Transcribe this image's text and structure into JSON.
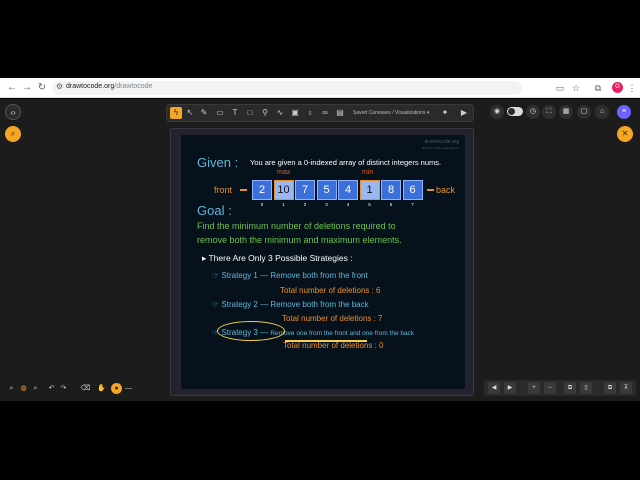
{
  "browser": {
    "url_host": "drawtocode.org",
    "url_path": "/drawtocode",
    "profile_initial": "G"
  },
  "toolbar": {
    "canvas_select": "Saved Canvases / Visualizations"
  },
  "board": {
    "watermark_site": "drawtocode.org",
    "watermark_tagline": "draw for more visualizations",
    "given_label": "Given :",
    "given_text": "You are given a 0-indexed array of distinct integers nums.",
    "max_label": "max",
    "min_label": "min",
    "front_label": "front",
    "back_label": "back",
    "array_values": [
      "2",
      "10",
      "7",
      "5",
      "4",
      "1",
      "8",
      "6"
    ],
    "array_indices": [
      "0",
      "1",
      "2",
      "3",
      "4",
      "5",
      "6",
      "7"
    ],
    "goal_label": "Goal :",
    "goal_line1": "Find the minimum number of deletions required to",
    "goal_line2": "remove both the minimum and maximum elements.",
    "section_title": "There Are Only 3 Possible Strategies :",
    "strategies": [
      {
        "label": "Strategy 1",
        "desc": "Remove both from the front",
        "total": "Total number of deletions :  6"
      },
      {
        "label": "Strategy 2",
        "desc": "Remove both from the back",
        "total": "Total number of deletions :  7"
      },
      {
        "label": "Strategy 3",
        "desc": "Remove one from the front and one from the back",
        "total": "Total number of deletions :  0"
      }
    ]
  },
  "colors": {
    "accent": "#f5a623",
    "cell_fill": "#3b6fd9",
    "highlight": "#e8912e",
    "heading": "#5fb8d8",
    "goal_text": "#6cc24a"
  }
}
